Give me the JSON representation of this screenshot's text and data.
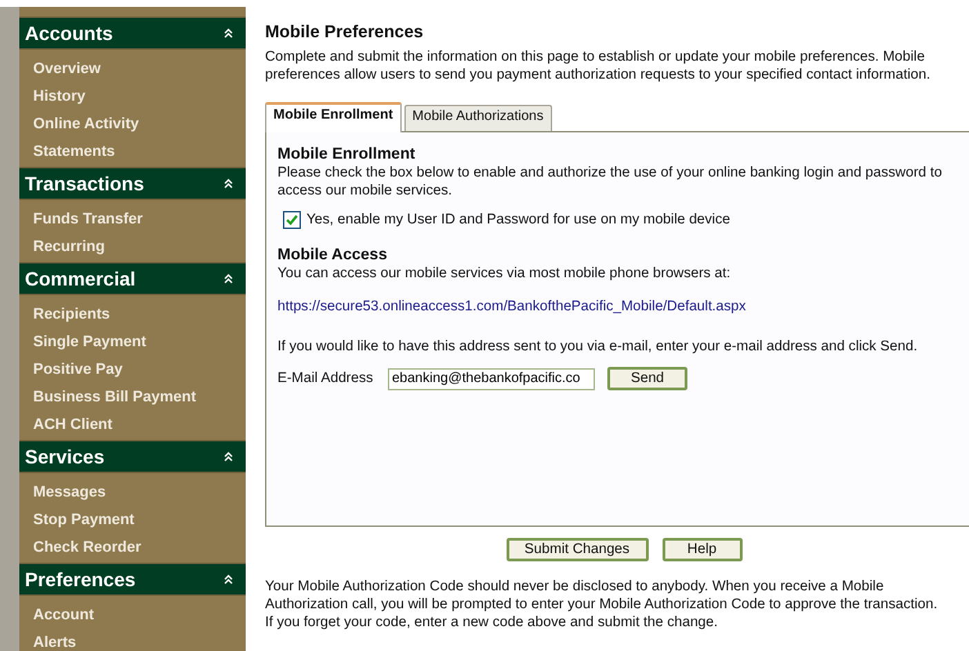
{
  "sidebar": {
    "sections": [
      {
        "title": "Accounts",
        "expanded": true,
        "items": [
          "Overview",
          "History",
          "Online Activity",
          "Statements"
        ]
      },
      {
        "title": "Transactions",
        "expanded": true,
        "items": [
          "Funds Transfer",
          "Recurring"
        ]
      },
      {
        "title": "Commercial",
        "expanded": true,
        "items": [
          "Recipients",
          "Single Payment",
          "Positive Pay",
          "Business Bill Payment",
          "ACH Client"
        ]
      },
      {
        "title": "Services",
        "expanded": true,
        "items": [
          "Messages",
          "Stop Payment",
          "Check Reorder"
        ]
      },
      {
        "title": "Preferences",
        "expanded": true,
        "items": [
          "Account",
          "Alerts"
        ]
      }
    ]
  },
  "page": {
    "title": "Mobile Preferences",
    "description": "Complete and submit the information on this page to establish or update your mobile preferences. Mobile preferences allow users to send you payment authorization requests to your specified contact information.",
    "tabs": [
      {
        "label": "Mobile Enrollment",
        "selected": true
      },
      {
        "label": "Mobile Authorizations",
        "selected": false
      }
    ],
    "enrollment": {
      "heading": "Mobile Enrollment",
      "text": "Please check the box below to enable and authorize the use of your online banking login and password to access our mobile services.",
      "checkbox": {
        "label": "Yes, enable my User ID and Password for use on my mobile device",
        "checked": true
      }
    },
    "access": {
      "heading": "Mobile Access",
      "text": "You can access our mobile services via most mobile phone browsers at:",
      "link": "https://secure53.onlineaccess1.com/BankofthePacific_Mobile/Default.aspx",
      "email_text": "If you would like to have this address sent to you via e-mail, enter your e-mail address and click Send.",
      "email_label": "E-Mail Address",
      "email_value": "ebanking@thebankofpacific.co",
      "send_button": "Send"
    },
    "buttons": [
      "Submit Changes",
      "Help"
    ],
    "footer": "Your Mobile Authorization Code should never be disclosed to anybody. When you receive a Mobile Authorization call, you will be prompted to enter your Mobile Authorization Code to approve the transaction. If you forget your code, enter a new code above and submit the change."
  }
}
